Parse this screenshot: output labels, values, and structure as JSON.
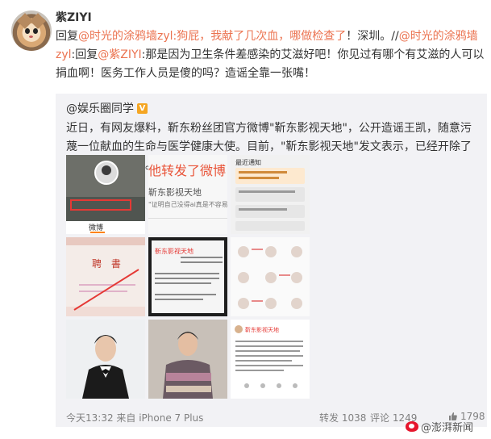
{
  "post": {
    "username": "紫ZIYI",
    "reply_prefix": "回复",
    "mention_1": "@时光的涂鸦墙zyl",
    "text_1": ":狗屁，我献了几次血，哪做检查了",
    "text_2": "！深圳。//",
    "mention_2": "@时光的涂鸦墙zyl",
    "text_3": ":回复",
    "mention_3": "@紫ZIYI",
    "text_4": ":那是因为卫生条件差感染的艾滋好吧！你见过有哪个有艾滋的人可以捐血啊！医务工作人员是傻的吗？造谣全靠一张嘴！"
  },
  "repost": {
    "source": "@娱乐圈同学",
    "badge": "V",
    "body": "近日，有网友爆料，靳东粉丝团官方微博\"靳东影视天地\"，公开造谣王凯，随意污蔑一位献血的生命与医学健康大使。目前，\"靳东影视天地\"发文表示，已经开除了涉事的管理人员。",
    "images": [
      {
        "caption": "微博"
      },
      {
        "caption": "他转发了微博",
        "sub": "靳东影视天地",
        "sub2": "\"证明自己没得ai真是不容易"
      },
      {
        "caption": "最近通知"
      },
      {
        "caption": "聘 書"
      },
      {
        "caption": "靳东影视天地"
      },
      {
        "caption": ""
      },
      {
        "caption": ""
      },
      {
        "caption": ""
      },
      {
        "caption": "靳东影视天地"
      }
    ]
  },
  "footer": {
    "time": "今天13:32 来自 iPhone 7 Plus",
    "retweet": "转发 1038",
    "comment": "评论 1249",
    "like": "1798",
    "watermark": "@澎湃新闻"
  },
  "colors": {
    "accent": "#eb7350",
    "badge": "#f5a623",
    "weibo_red": "#e6162d"
  }
}
